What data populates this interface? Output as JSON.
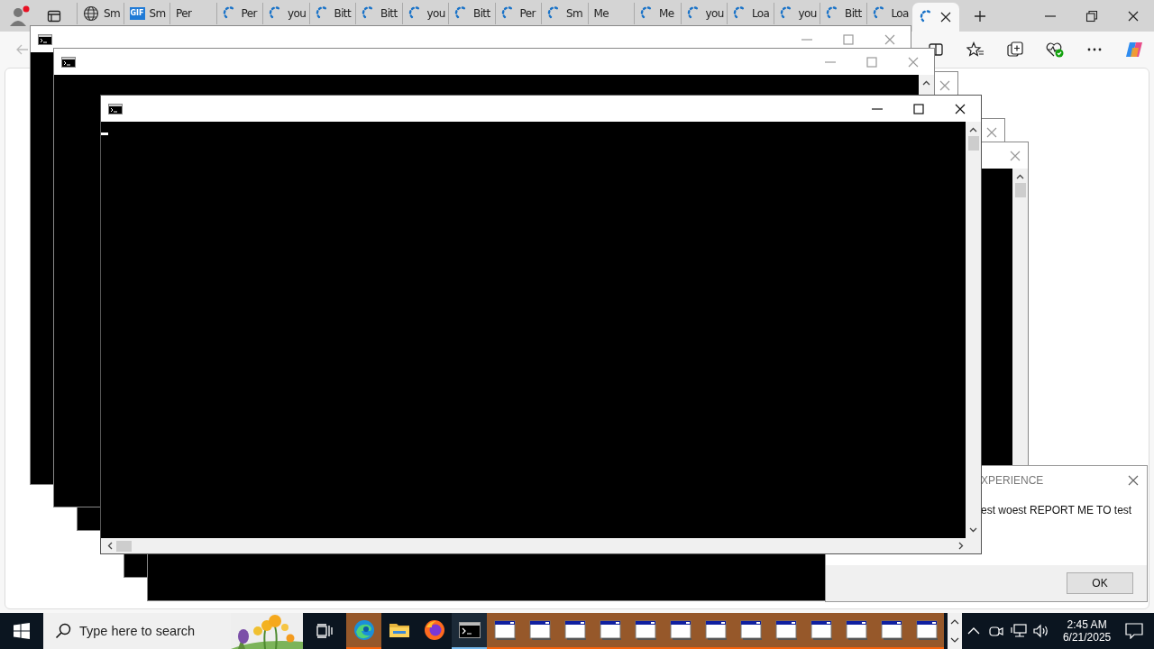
{
  "browser": {
    "tabs": [
      {
        "kind": "globe",
        "label": "Sm",
        "selected": false
      },
      {
        "kind": "gif",
        "favicon_text": "GIF",
        "label": "Sm",
        "selected": false
      },
      {
        "kind": "none",
        "label": "Per",
        "selected": false
      },
      {
        "kind": "loading",
        "label": "Per",
        "selected": false
      },
      {
        "kind": "loading",
        "label": "you",
        "selected": false
      },
      {
        "kind": "loading",
        "label": "Bitt",
        "selected": false
      },
      {
        "kind": "loading",
        "label": "Bitt",
        "selected": false
      },
      {
        "kind": "loading",
        "label": "you",
        "selected": false
      },
      {
        "kind": "loading",
        "label": "Bitt",
        "selected": false
      },
      {
        "kind": "loading",
        "label": "Per",
        "selected": false
      },
      {
        "kind": "loading",
        "label": "Sm",
        "selected": false
      },
      {
        "kind": "none",
        "label": "Me",
        "selected": false
      },
      {
        "kind": "loading",
        "label": "Me",
        "selected": false
      },
      {
        "kind": "loading",
        "label": "you",
        "selected": false
      },
      {
        "kind": "loading",
        "label": "Loa",
        "selected": false
      },
      {
        "kind": "loading",
        "label": "you",
        "selected": false
      },
      {
        "kind": "loading",
        "label": "Bitt",
        "selected": false
      },
      {
        "kind": "loading",
        "label": "Loa",
        "selected": false
      },
      {
        "kind": "loading",
        "selected": true
      }
    ],
    "back_disabled": true
  },
  "console_windows": [
    {
      "active": false
    },
    {
      "active": false
    },
    {
      "active": false
    },
    {
      "active": false
    },
    {
      "active": false
    },
    {
      "active": true,
      "cursor": true
    }
  ],
  "dialog": {
    "title": "XPERIENCE",
    "message": "est woest REPORT ME TO test",
    "button": "OK"
  },
  "taskbar": {
    "search": {
      "placeholder": "Type here to search"
    },
    "apps": [
      {
        "kind": "edge",
        "flashing": true,
        "selected": false
      },
      {
        "kind": "explorer",
        "flashing": false,
        "selected": false
      },
      {
        "kind": "firefox",
        "flashing": false,
        "selected": false
      },
      {
        "kind": "console",
        "flashing": false,
        "selected": true
      },
      {
        "kind": "window",
        "flashing": true,
        "selected": false
      },
      {
        "kind": "window",
        "flashing": true,
        "selected": false
      },
      {
        "kind": "window",
        "flashing": true,
        "selected": false
      },
      {
        "kind": "window",
        "flashing": true,
        "selected": false
      },
      {
        "kind": "window",
        "flashing": true,
        "selected": false
      },
      {
        "kind": "window",
        "flashing": true,
        "selected": false
      },
      {
        "kind": "window",
        "flashing": true,
        "selected": false
      },
      {
        "kind": "window",
        "flashing": true,
        "selected": false
      },
      {
        "kind": "window",
        "flashing": true,
        "selected": false
      },
      {
        "kind": "window",
        "flashing": true,
        "selected": false
      },
      {
        "kind": "window",
        "flashing": true,
        "selected": false
      },
      {
        "kind": "window",
        "flashing": true,
        "selected": false
      },
      {
        "kind": "window",
        "flashing": true,
        "selected": false
      }
    ],
    "clock": {
      "time": "2:45 AM",
      "date": "6/21/2025"
    }
  }
}
